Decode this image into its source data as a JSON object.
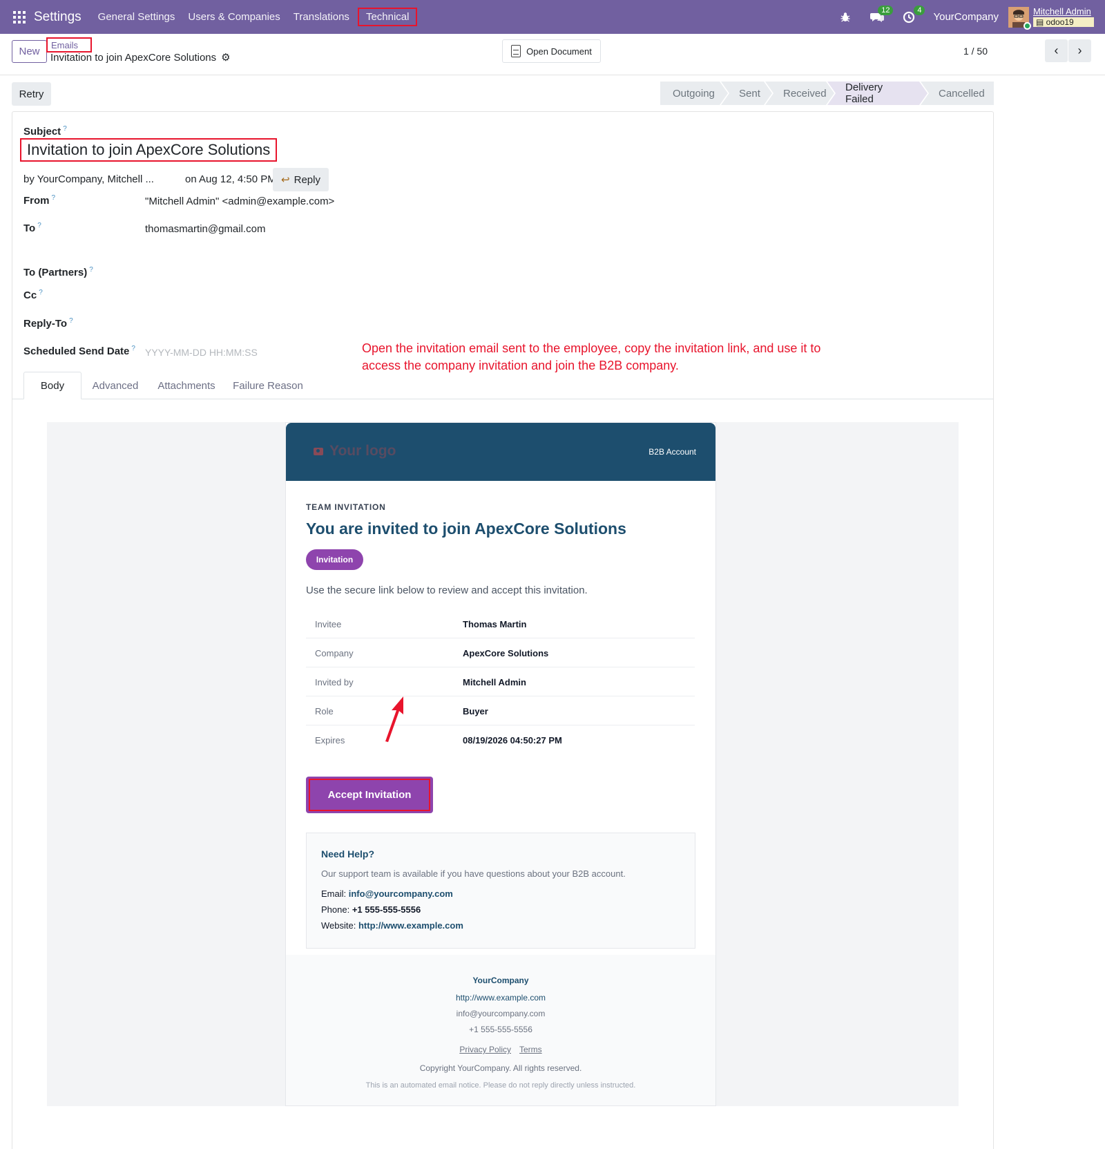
{
  "navbar": {
    "app_title": "Settings",
    "menu": [
      "General Settings",
      "Users & Companies",
      "Translations",
      "Technical"
    ],
    "messages_count": "12",
    "activities_count": "4",
    "company": "YourCompany",
    "user_name": "Mitchell Admin",
    "db_name": "odoo19",
    "bg_color": "#7160a0"
  },
  "control": {
    "new_label": "New",
    "breadcrumb": "Emails",
    "record_title": "Invitation to join ApexCore Solutions",
    "open_document_label": "Open Document",
    "pager": "1 / 50"
  },
  "statusbar": {
    "retry_label": "Retry",
    "stages": [
      "Outgoing",
      "Sent",
      "Received",
      "Delivery Failed",
      "Cancelled"
    ],
    "active_stage": "Delivery Failed"
  },
  "form": {
    "subject_label": "Subject",
    "subject_value": "Invitation to join ApexCore Solutions",
    "by_text": "by  YourCompany, Mitchell ...",
    "on_text": "on Aug 12, 4:50 PM",
    "reply_label": "Reply",
    "from_label": "From",
    "from_value": "\"Mitchell Admin\" <admin@example.com>",
    "to_label": "To",
    "to_value": "thomasmartin@gmail.com",
    "to_partners_label": "To (Partners)",
    "cc_label": "Cc",
    "reply_to_label": "Reply-To",
    "scheduled_label": "Scheduled Send Date",
    "scheduled_placeholder": "YYYY-MM-DD HH:MM:SS"
  },
  "annotation": "Open the invitation email sent to the employee, copy the invitation link, and use it to access the company invitation and join the B2B company.",
  "tabs": [
    "Body",
    "Advanced",
    "Attachments",
    "Failure Reason"
  ],
  "email": {
    "logo_text": "Your logo",
    "header_label": "B2B Account",
    "kicker": "TEAM INVITATION",
    "title": "You are invited to join ApexCore Solutions",
    "pill": "Invitation",
    "description": "Use the secure link below to review and accept this invitation.",
    "details": [
      {
        "key": "Invitee",
        "value": "Thomas Martin"
      },
      {
        "key": "Company",
        "value": "ApexCore Solutions"
      },
      {
        "key": "Invited by",
        "value": "Mitchell Admin"
      },
      {
        "key": "Role",
        "value": "Buyer"
      },
      {
        "key": "Expires",
        "value": "08/19/2026 04:50:27 PM"
      }
    ],
    "accept_label": "Accept Invitation",
    "help_title": "Need Help?",
    "help_desc": "Our support team is available if you have questions about your B2B account.",
    "email_label": "Email:",
    "email_value": "info@yourcompany.com",
    "phone_label": "Phone:",
    "phone_value": "+1 555-555-5556",
    "website_label": "Website:",
    "website_value": "http://www.example.com",
    "footer_company": "YourCompany",
    "footer_website": "http://www.example.com",
    "footer_email": "info@yourcompany.com",
    "footer_phone": "+1 555-555-5556",
    "privacy": "Privacy Policy",
    "terms": "Terms",
    "copyright": "Copyright YourCompany. All rights reserved.",
    "notice": "This is an automated email notice. Please do not reply directly unless instructed.",
    "header_color": "#1d4e6e",
    "accent_color": "#8e44ad"
  }
}
